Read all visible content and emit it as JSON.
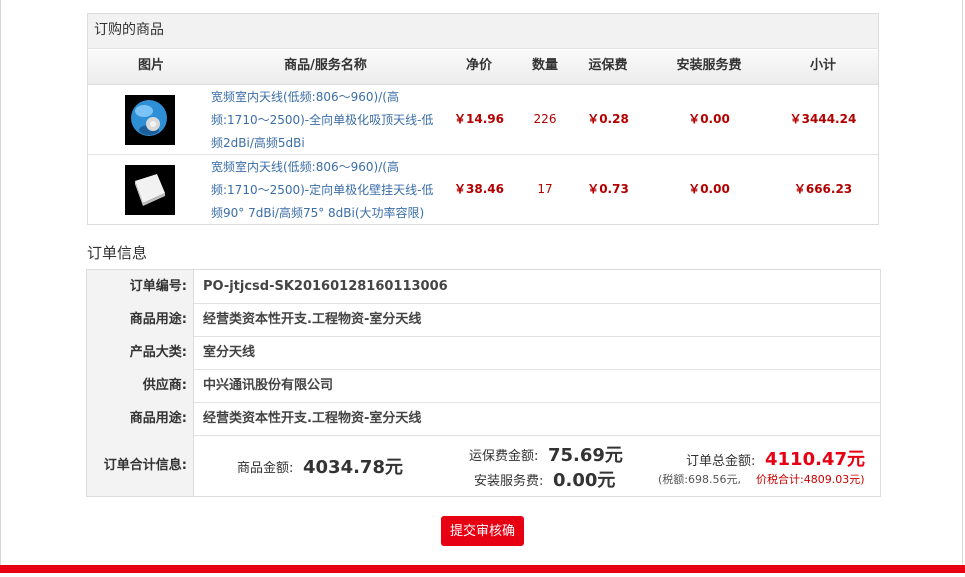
{
  "goods": {
    "title": "订购的商品",
    "columns": [
      "图片",
      "商品/服务名称",
      "净价",
      "数量",
      "运保费",
      "安装服务费",
      "小计"
    ],
    "items": [
      {
        "name": "宽频室内天线(低频:806～960)/(高频:1710～2500)-全向单极化吸顶天线-低频2dBi/高频5dBi",
        "image_icon": "ceiling-omni-antenna-image",
        "price": "￥14.96",
        "qty": "226",
        "shipping": "￥0.28",
        "install": "￥0.00",
        "subtotal": "￥3444.24"
      },
      {
        "name": "宽频室内天线(低频:806～960)/(高频:1710～2500)-定向单极化壁挂天线-低频90° 7dBi/高频75° 8dBi(大功率容限)",
        "image_icon": "wall-panel-antenna-image",
        "price": "￥38.46",
        "qty": "17",
        "shipping": "￥0.73",
        "install": "￥0.00",
        "subtotal": "￥666.23"
      }
    ]
  },
  "order": {
    "heading": "订单信息",
    "rows": [
      {
        "label": "订单编号:",
        "value": "PO-jtjcsd-SK20160128160113006"
      },
      {
        "label": "商品用途:",
        "value": "经营类资本性开支.工程物资-室分天线"
      },
      {
        "label": "产品大类:",
        "value": "室分天线"
      },
      {
        "label": "供应商:",
        "value": "中兴通讯股份有限公司"
      },
      {
        "label": "商品用途:",
        "value": "经营类资本性开支.工程物资-室分天线"
      }
    ],
    "summary": {
      "label": "订单合计信息:",
      "goods_label": "商品金额:",
      "goods_amount": "4034.78元",
      "shipping_label": "运保费金额:",
      "shipping_amount": "75.69元",
      "install_label": "安装服务费:",
      "install_amount": "0.00元",
      "total_label": "订单总金额:",
      "total_amount": "4110.47元",
      "tax_text": "(税额:698.56元,",
      "tax_total_text": "价税合计:4809.03元)"
    }
  },
  "actions": {
    "submit_label": "提交审核确认"
  },
  "colors": {
    "accent": "#e60012",
    "price": "#b30000",
    "link": "#3a6ea8"
  }
}
